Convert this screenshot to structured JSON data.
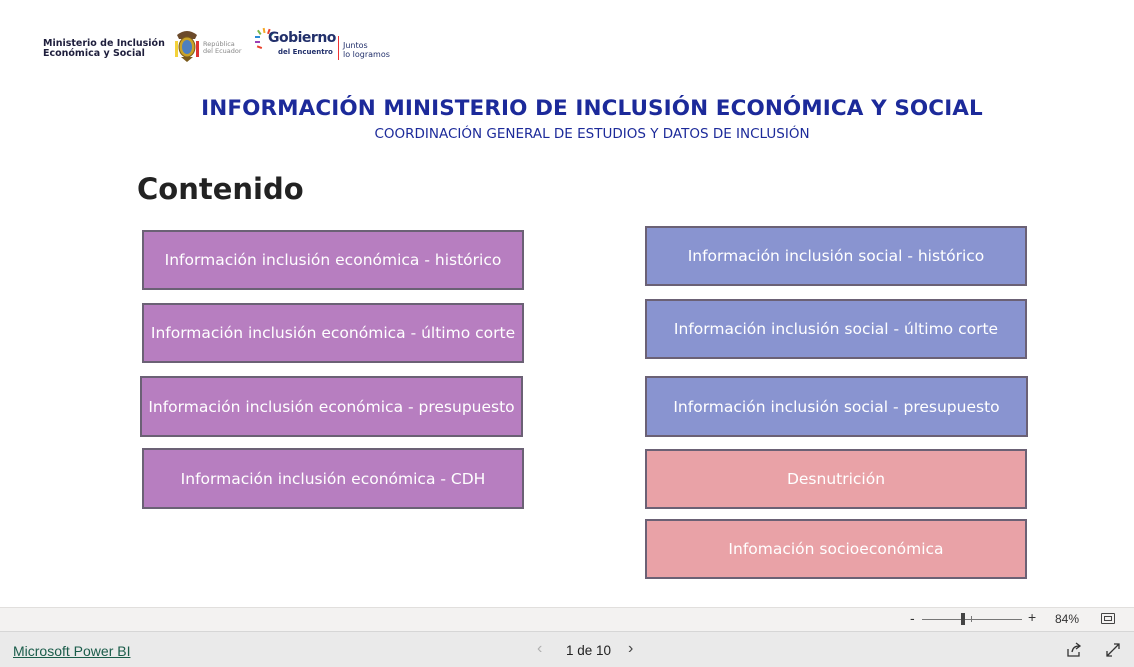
{
  "header": {
    "mies_logo_line1": "Ministerio de Inclusión",
    "mies_logo_line2": "Económica y Social",
    "republica_line1": "República",
    "republica_line2": "del Ecuador",
    "gobierno_title": "Gobierno",
    "gobierno_sub": "del Encuentro",
    "slogan_line1": "Juntos",
    "slogan_line2": "lo logramos",
    "title": "INFORMACIÓN MINISTERIO DE INCLUSIÓN ECONÓMICA Y SOCIAL",
    "subtitle": "COORDINACIÓN GENERAL DE ESTUDIOS Y DATOS DE INCLUSIÓN"
  },
  "content": {
    "heading": "Contenido",
    "economic_buttons": [
      "Información inclusión económica - histórico",
      "Información inclusión económica - último corte",
      "Información inclusión económica - presupuesto",
      "Información inclusión económica - CDH"
    ],
    "social_buttons": [
      "Información inclusión social - histórico",
      "Información inclusión social - último corte",
      "Información inclusión social - presupuesto",
      "Desnutrición",
      "Infomación socioeconómica"
    ]
  },
  "zoom": {
    "minus": "-",
    "plus": "+",
    "level": "84%"
  },
  "footer": {
    "brand_link": "Microsoft Power BI",
    "prev": "‹",
    "page_indicator": "1 de 10",
    "next": "›"
  },
  "colors": {
    "title_blue": "#1c2a9a",
    "economic_button": "#b77ec0",
    "social_button": "#8994d0",
    "nutrition_button": "#e9a2a7"
  }
}
